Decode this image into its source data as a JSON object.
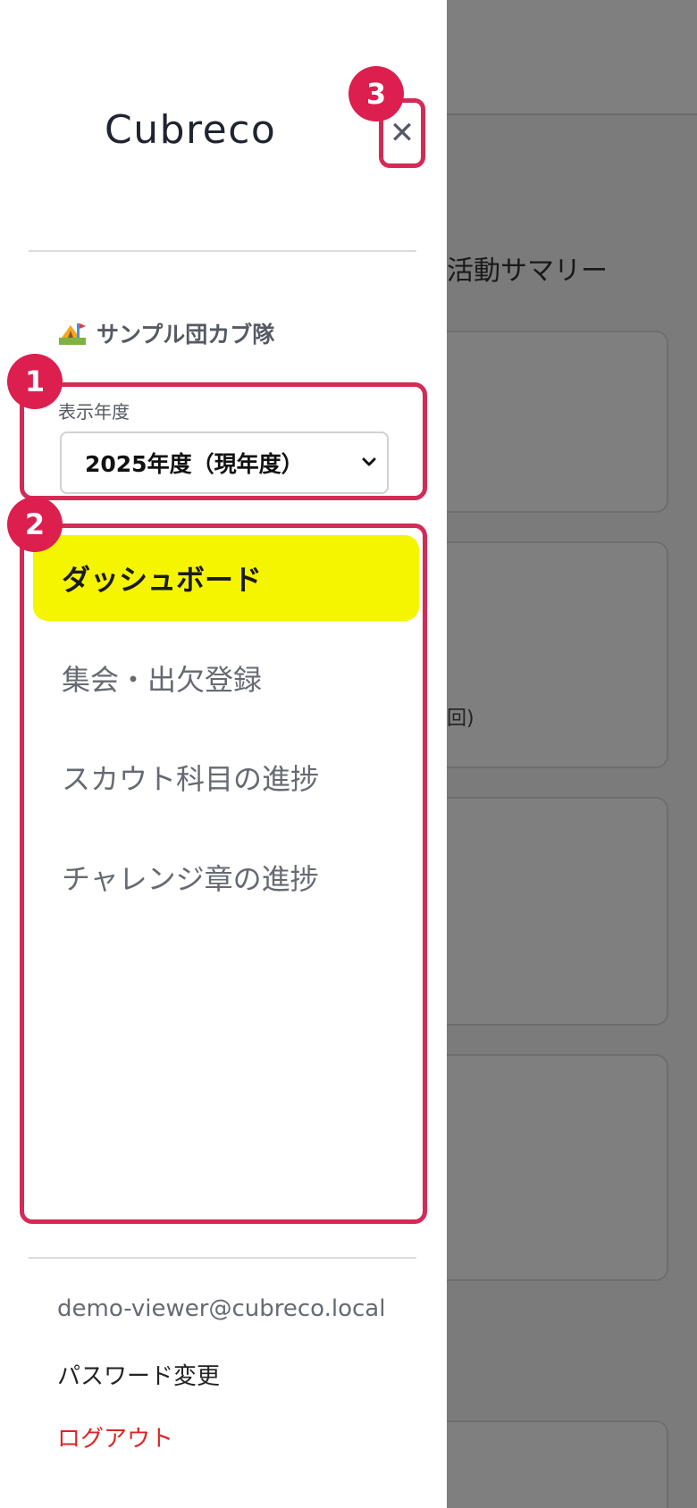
{
  "background": {
    "section_title": "活動サマリー",
    "card_note": "回)"
  },
  "drawer": {
    "logo": "Cubreco",
    "close_icon": "close-icon",
    "team": {
      "icon": "camp-icon",
      "name": "サンプル団カブ隊"
    },
    "year": {
      "label": "表示年度",
      "selected": "2025年度（現年度）"
    },
    "nav": [
      {
        "label": "ダッシュボード",
        "active": true
      },
      {
        "label": "集会・出欠登録",
        "active": false
      },
      {
        "label": "スカウト科目の進捗",
        "active": false
      },
      {
        "label": "チャレンジ章の進捗",
        "active": false
      }
    ],
    "footer": {
      "email": "demo-viewer@cubreco.local",
      "password_change": "パスワード変更",
      "logout": "ログアウト"
    }
  },
  "badges": [
    "1",
    "2",
    "3"
  ],
  "colors": {
    "highlight": "#d42a56",
    "badge": "#dc1f4e",
    "active_nav": "#f6f500",
    "logout": "#dc2626"
  }
}
